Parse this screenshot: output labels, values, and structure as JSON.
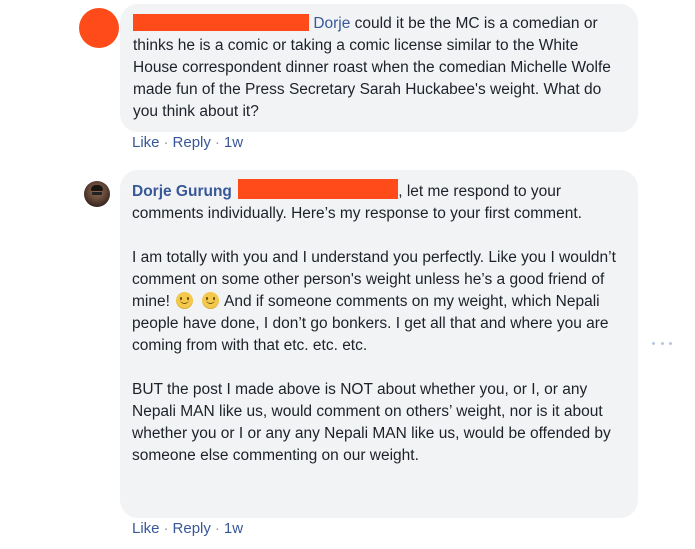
{
  "comments": [
    {
      "mention": "Dorje",
      "text": " could it be the MC is a comedian or thinks he is a comic or taking a comic license similar to the White House correspondent dinner roast when the comedian Michelle Wolfe made fun of the Press Secretary Sarah Huckabee's weight. What do you think about it?",
      "actions": {
        "like": "Like",
        "reply": "Reply",
        "time": "1w"
      }
    },
    {
      "author": "Dorje Gurung",
      "intro": ", let me respond to your comments individually. Here’s my response to your first comment.",
      "para2_a": "I am totally with you and I understand you perfectly. Like you I wouldn’t comment on some other person's weight unless he’s a good friend of mine!",
      "para2_b": " And if someone comments on my weight, which Nepali people have done, I don’t go bonkers. I get all that and where you are coming from with that etc. etc. etc.",
      "para3": "BUT the post I made above is NOT about whether you, or I, or any Nepali MAN like us, would comment on others’ weight, nor is it about whether you or I or any any Nepali MAN like us, would be offended by someone else commenting on our weight.",
      "actions": {
        "like": "Like",
        "reply": "Reply",
        "time": "1w"
      }
    }
  ],
  "separator": "·",
  "icons": {
    "emoji": "slightly-smiling-face-icon",
    "options": "more-options-icon"
  },
  "colors": {
    "link": "#385898",
    "bubble": "#f2f3f5",
    "redaction": "#ff4a1a"
  }
}
